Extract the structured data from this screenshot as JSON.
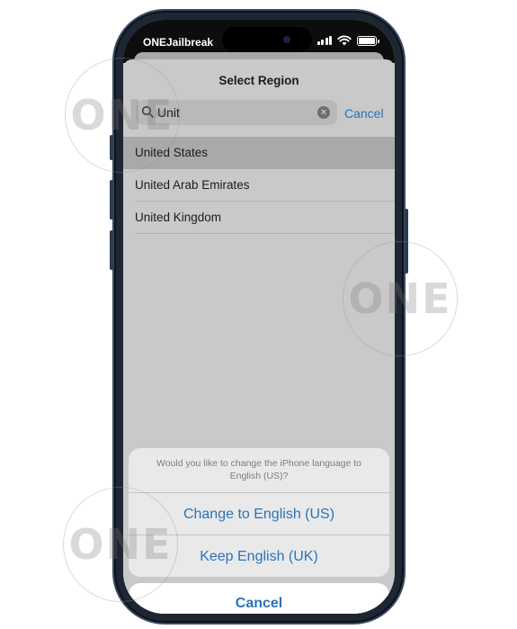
{
  "status_bar": {
    "carrier": "ONEJailbreak"
  },
  "region_sheet": {
    "title": "Select Region",
    "search": {
      "value": "Unit",
      "cancel_label": "Cancel"
    },
    "results": [
      {
        "label": "United States",
        "selected": true
      },
      {
        "label": "United Arab Emirates",
        "selected": false
      },
      {
        "label": "United Kingdom",
        "selected": false
      }
    ]
  },
  "action_sheet": {
    "message": "Would you like to change the iPhone language to English (US)?",
    "change_label": "Change to English (US)",
    "keep_label": "Keep English (UK)",
    "cancel_label": "Cancel"
  },
  "watermark": {
    "text": "ONE"
  },
  "colors": {
    "accent": "#2a74b8",
    "frame": "#1f2633",
    "dimmed_background": "#c9c9c9"
  }
}
